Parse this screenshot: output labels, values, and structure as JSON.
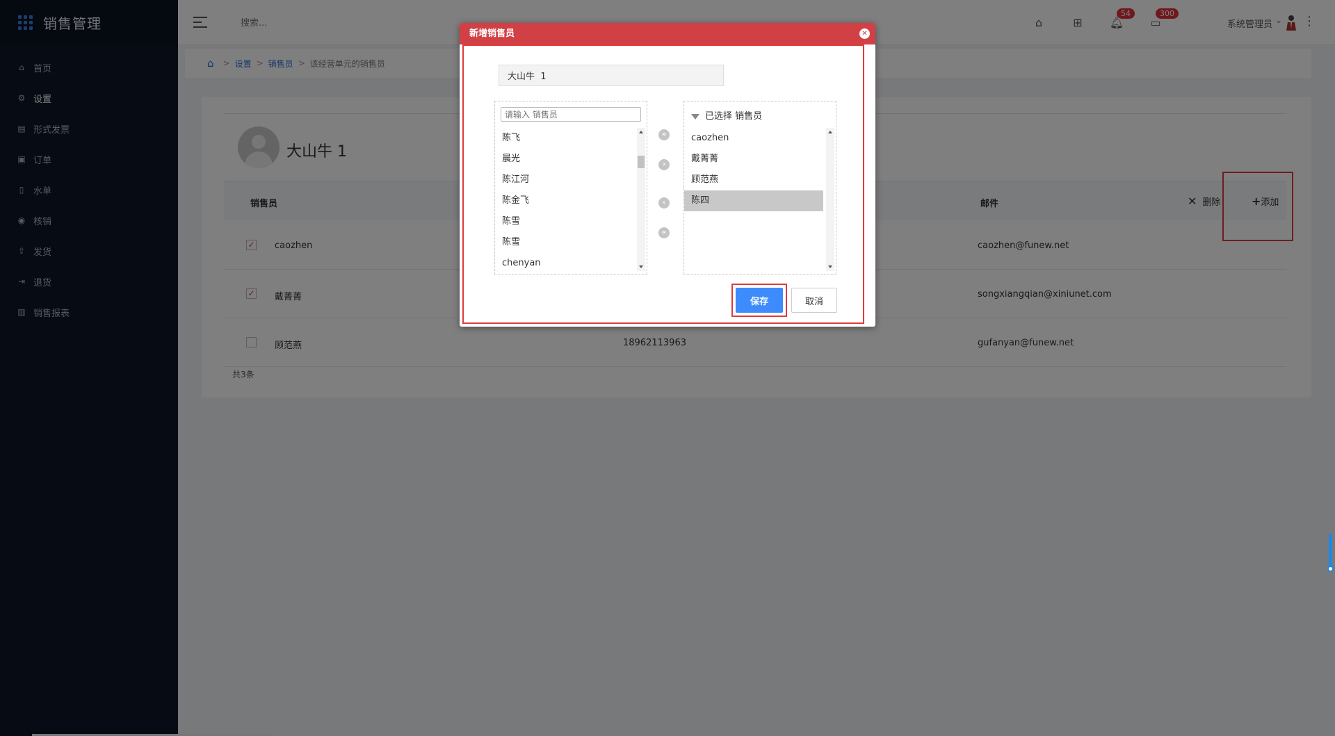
{
  "app": {
    "title": "销售管理"
  },
  "sidebar": {
    "items": [
      {
        "label": "首页",
        "icon": "home-icon"
      },
      {
        "label": "设置",
        "icon": "gear-icon"
      },
      {
        "label": "形式发票",
        "icon": "invoice-icon"
      },
      {
        "label": "订单",
        "icon": "order-icon"
      },
      {
        "label": "水单",
        "icon": "receipt-icon"
      },
      {
        "label": "核销",
        "icon": "check-circle-icon"
      },
      {
        "label": "发货",
        "icon": "upload-icon"
      },
      {
        "label": "退货",
        "icon": "return-icon"
      },
      {
        "label": "销售报表",
        "icon": "bar-chart-icon"
      }
    ]
  },
  "header": {
    "search_placeholder": "搜索...",
    "notifications_count": "54",
    "messages_count": "300",
    "user_name": "系统管理员"
  },
  "breadcrumb": {
    "items": [
      "设置",
      "销售员",
      "该经营单元的销售员"
    ],
    "separator": ">"
  },
  "profile": {
    "name": "大山牛 1"
  },
  "table": {
    "headers": {
      "salesperson": "销售员",
      "email": "邮件",
      "delete": "删除",
      "add": "添加"
    },
    "rows": [
      {
        "checked": true,
        "name": "caozhen",
        "phone": "",
        "email": "caozhen@funew.net"
      },
      {
        "checked": true,
        "name": "戴菁菁",
        "phone": "",
        "email": "songxiangqian@xiniunet.com"
      },
      {
        "checked": false,
        "name": "顾范燕",
        "phone": "18962113963",
        "email": "gufanyan@funew.net"
      }
    ],
    "total": "共3条"
  },
  "dialog": {
    "title": "新增销售员",
    "dealer_value": "大山牛  1",
    "left_search_placeholder": "请输入 销售员",
    "left_items": [
      "陈飞",
      "晨光",
      "陈江河",
      "陈金飞",
      "陈雪",
      "陈雪",
      "chenyan"
    ],
    "right_header": "已选择 销售员",
    "right_items": [
      "caozhen",
      "戴菁菁",
      "顾范燕",
      "陈四"
    ],
    "right_selected": "陈四",
    "save_label": "保存",
    "cancel_label": "取消"
  },
  "colors": {
    "accent": "#3d8bfd",
    "dialog_header": "#d04045",
    "highlight": "#e03a3a",
    "sidebar": "#0e1726"
  }
}
